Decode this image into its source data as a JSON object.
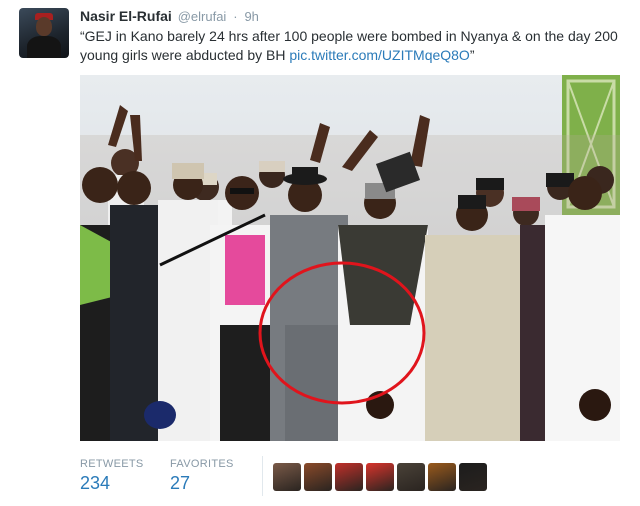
{
  "tweet": {
    "fullname": "Nasir El-Rufai",
    "username": "@elrufai",
    "separator": "·",
    "time": "9h",
    "text": "“GEJ in Kano barely 24 hrs after 100 people were bombed in Nyanya & on the day 200 young girls were abducted by BH ",
    "link": "pic.twitter.com/UZITMqeQ8O",
    "text_end": "”"
  },
  "stats": {
    "retweets_label": "RETWEETS",
    "retweets_count": "234",
    "favorites_label": "FAVORITES",
    "favorites_count": "27"
  },
  "favoriters": [
    {
      "name": "favoriter-avatar-1",
      "color": "#7a5a48"
    },
    {
      "name": "favoriter-avatar-2",
      "color": "#8a4a2a"
    },
    {
      "name": "favoriter-avatar-3",
      "color": "#c0302a"
    },
    {
      "name": "favoriter-avatar-4",
      "color": "#d8342c"
    },
    {
      "name": "favoriter-avatar-5",
      "color": "#4a4238"
    },
    {
      "name": "favoriter-avatar-6",
      "color": "#9a5a1c"
    },
    {
      "name": "favoriter-avatar-7",
      "color": "#1c1c1c"
    }
  ],
  "colors": {
    "link": "#2b7bb9",
    "muted": "#8899a6",
    "annotation_circle": "#e0141c"
  }
}
